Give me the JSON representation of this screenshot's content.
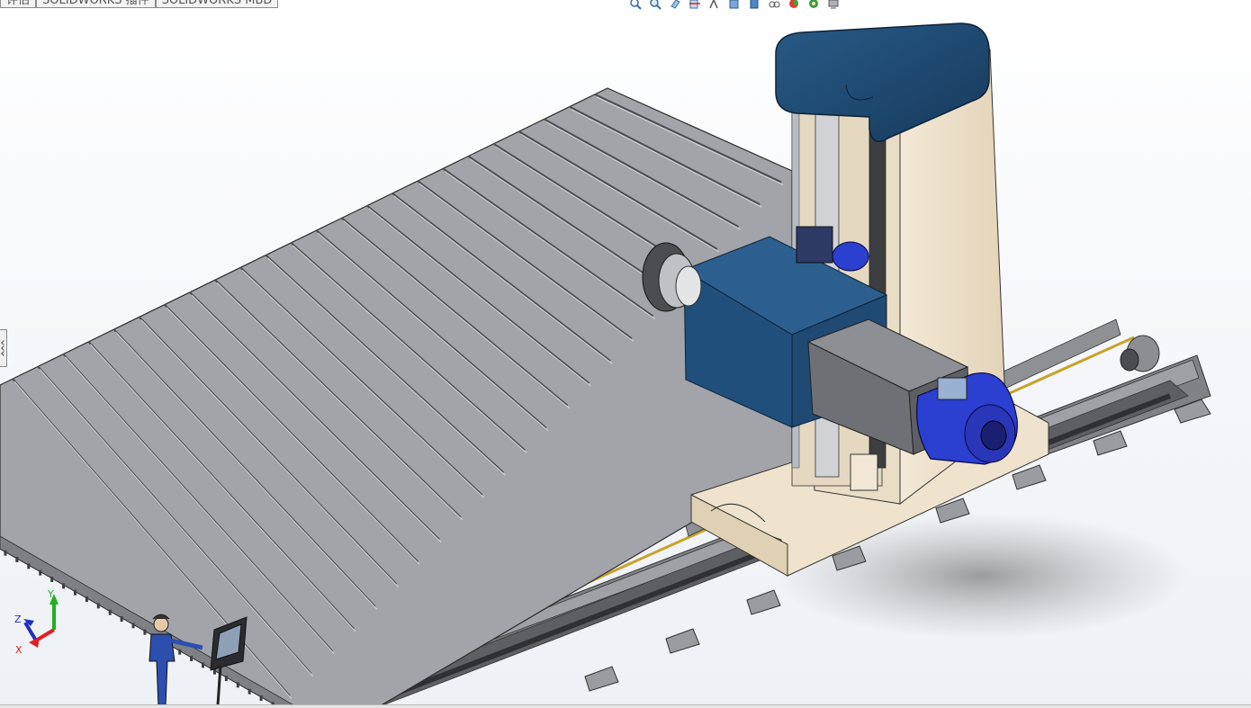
{
  "tabs": [
    {
      "label": "评估"
    },
    {
      "label": "SOLIDWORKS 插件"
    },
    {
      "label": "SOLIDWORKS MBD"
    }
  ],
  "heads_up_toolbar": [
    {
      "icon": "zoom-to-fit-icon"
    },
    {
      "icon": "zoom-to-area-icon"
    },
    {
      "icon": "previous-view-icon"
    },
    {
      "icon": "section-view-icon"
    },
    {
      "icon": "dynamic-annotation-views-icon"
    },
    {
      "icon": "view-orientation-icon"
    },
    {
      "icon": "display-style-icon"
    },
    {
      "icon": "hide-show-items-icon"
    },
    {
      "icon": "edit-appearance-icon"
    },
    {
      "icon": "apply-scene-icon"
    },
    {
      "icon": "view-settings-icon"
    }
  ],
  "triad": {
    "x_label": "X",
    "y_label": "Y",
    "z_label": "Z",
    "x_color": "#e02020",
    "y_color": "#20b020",
    "z_color": "#2030c0"
  },
  "colors": {
    "table_gray": "#9c9ea3",
    "column_cream": "#efe2cc",
    "head_blue": "#1f4d77",
    "motor_blue": "#2b3fd0",
    "bed_gray": "#7a7c80"
  }
}
